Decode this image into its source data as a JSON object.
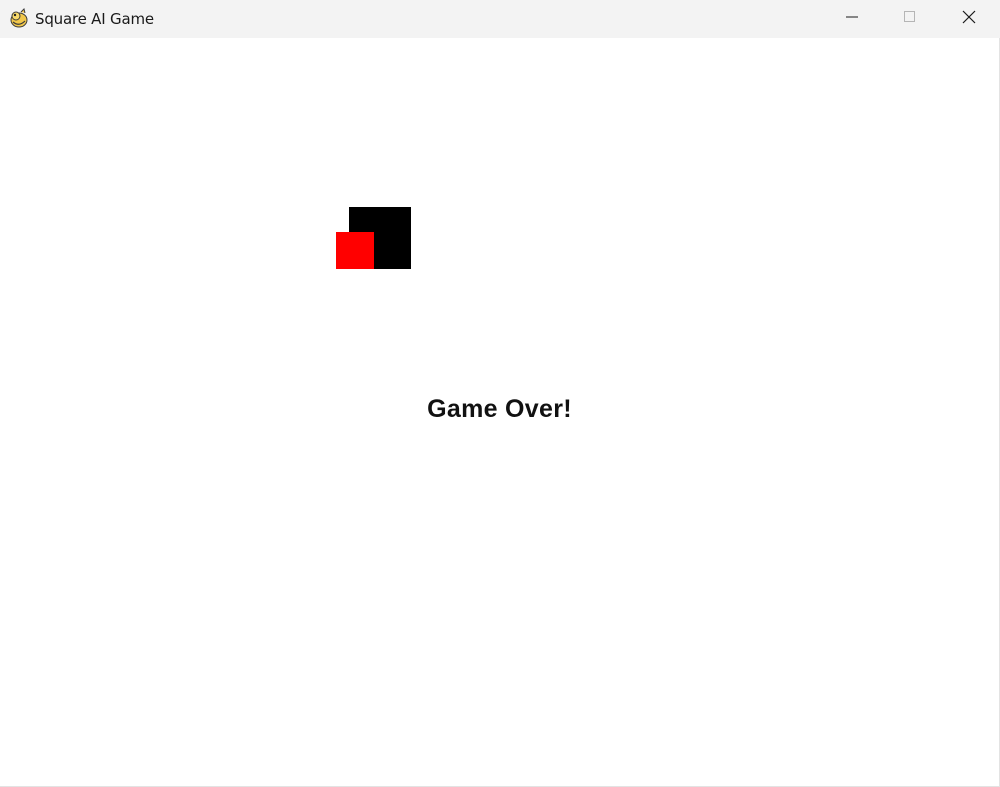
{
  "window": {
    "title": "Square AI Game",
    "icon": "pygame-snake-icon"
  },
  "controls": {
    "minimize_icon": "minimize-icon",
    "maximize_icon": "maximize-icon",
    "close_icon": "close-icon"
  },
  "game": {
    "status_text": "Game Over!",
    "colors": {
      "background": "#ffffff",
      "ai_square": "#000000",
      "player_square": "#ff0000",
      "text": "#111111"
    }
  }
}
